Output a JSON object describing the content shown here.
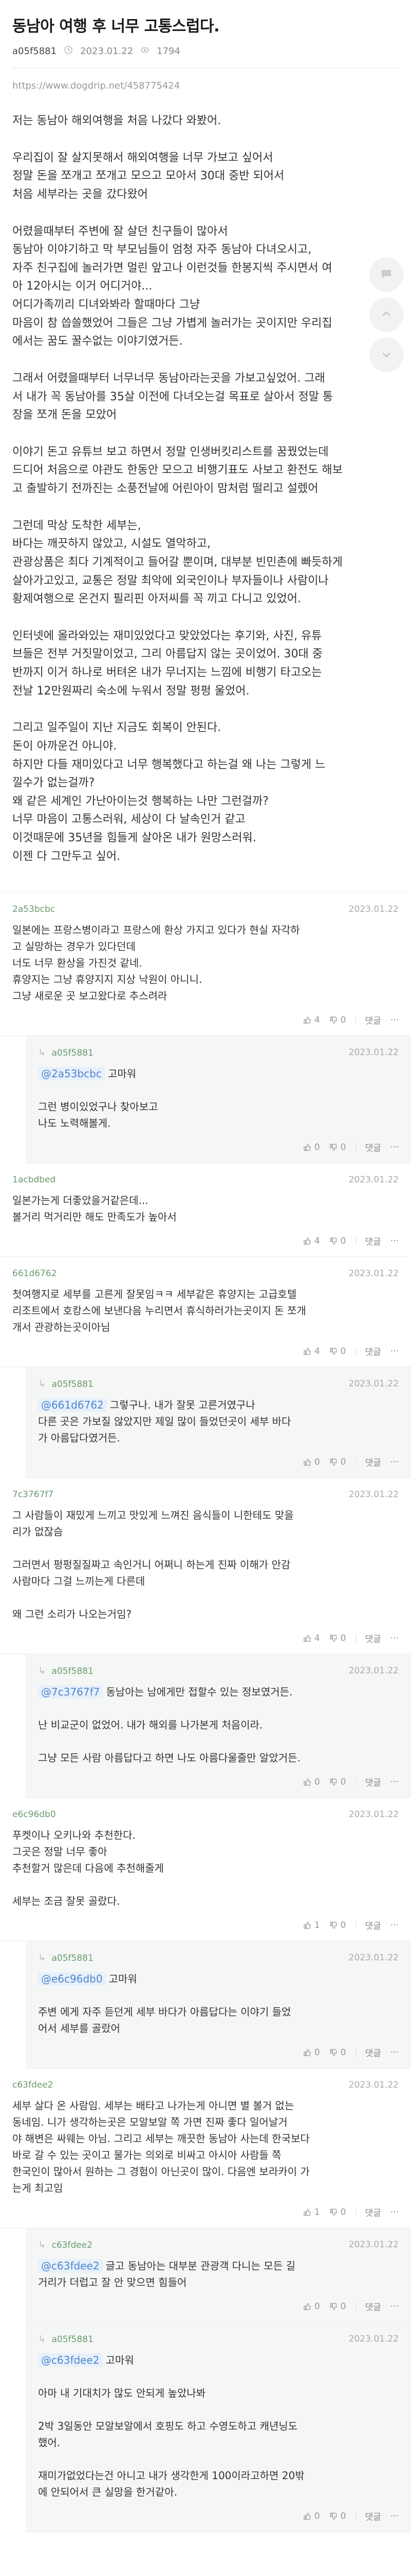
{
  "post": {
    "title": "동남아 여행 후 너무 고통스럽다.",
    "author": "a05f5881",
    "date": "2023.01.22",
    "views": "1794",
    "source": "https://www.dogdrip.net/458775424"
  },
  "body": [
    "저는 동남아 해외여행을 처음 나갔다 와봤어.",
    "우리집이 잘 살지못해서 해외여행을 너무 가보고 싶어서\n정말 돈을 쪼개고 쪼개고 모으고 모아서 30대 중반 되어서\n처음 세부라는 곳을 갔다왔어",
    "어렸을때부터 주변에 잘 살던 친구들이 많아서\n동남아 이야기하고 막 부모님들이 엄청 자주 동남아 다녀오시고,\n자주 친구집에 놀러가면 멀린 앞고나 이런것들 한봉지씩 주시면서 여\n아 12아시는 이거 어디거야...\n어디가족끼리 디녀와봐라 할때마다 그냥\n마음이 참 씁쓸했었어 그들은 그냥 가볍게 놀러가는 곳이지만 우리집\n에서는 꿈도 꿀수없는 이야기였거든.",
    "그래서 어렸을때부터 너무너무 동남아라는곳을 가보고싶었어. 그래\n서 내가 꼭 동남아를 35살 이전에 다녀오는걸 목표로 살아서 정말 통\n장을 쪼개 돈을 모았어",
    "이야기 돈고 유튜브 보고 하면서 정말 인생버킷리스트를 꿈꿨었는데\n드디어 처음으로 야관도 한동안 모으고 비행기표도 사보고 환전도 해보\n고 출발하기 전까진는 소풍전날에 어린아이 맘처럼 떨리고 설렜어",
    "그런데 막상 도착한 세부는,\n바다는 깨끗하지 않았고, 시설도 열악하고,\n관광상품은 최다 기계적이고 들어갈 뿐이며, 대부분 빈민촌에 빠듯하게\n살아가고있고, 교통은 정말 최악에 외국인이나 부자들이나 사람이나\n황제여행으로 온건지 필리핀 아저씨를 꼭 끼고 다니고 있었어.",
    "인터넷에 올라와있는 재미있었다고 맞았었다는 후기와, 사진, 유튜\n브들은 전부 거짓말이었고, 그리 아름답지 않는 곳이었어. 30대 중\n반까지 이거 하나로 버텨온 내가 무너지는 느낌에 비행기 타고오는\n전날 12만원짜리 숙소에 누워서 정말 펑펑 울었어.",
    "그리고 일주일이 지난 지금도 회복이 안된다.\n돈이 아까운건 아니야.\n하지만 다들 재미있다고 너무 행복했다고 하는걸 왜 나는 그렇게 느\n낄수가 없는걸까?\n왜 같은 세계인 가난아이는것 행복하는 나만 그런걸까?\n너무 마음이 고통스러워, 세상이 다 날속인거 같고\n이것때문에  35년을 힘들게 살아온 내가 원망스러워.\n이젠 다 그만두고 싶어."
  ],
  "comments": [
    {
      "nick": "2a53bcbc",
      "date": "2023.01.22",
      "mention": "",
      "text": "일본에는 프랑스병이라고 프랑스에 환상 가지고 있다가 현실 자각하\n고 실망하는 경우가 있다던데\n너도 너무 환상을 가진것 같네.\n휴양지는 그냥 휴양지지 지상 낙원이 아니니.\n그냥 새로운 곳 보고왔다로 추스려라",
      "likes": "4",
      "dislikes": "0",
      "reply": false
    },
    {
      "nick": "a05f5881",
      "date": "2023.01.22",
      "mention": "@2a53bcbc",
      "text": "고마워\n\n그런 병이있었구나 찾아보고\n나도 노력해볼게.",
      "likes": "0",
      "dislikes": "0",
      "reply": true
    },
    {
      "nick": "1acbdbed",
      "date": "2023.01.22",
      "mention": "",
      "text": "일본가는게 더좋았을거같은데...\n볼거리 먹거리만 해도 만족도가 높아서",
      "likes": "4",
      "dislikes": "0",
      "reply": false
    },
    {
      "nick": "661d6762",
      "date": "2023.01.22",
      "mention": "",
      "text": "첫여행지로 세부를 고른게 잘못임ㅋㅋ 세부같은 휴양지는 고급호텔\n리조트에서 호캉스에 보낸다음 누리면서 휴식하러가는곳이지 돈 쪼개\n개서 관광하는곳이아님",
      "likes": "4",
      "dislikes": "0",
      "reply": false
    },
    {
      "nick": "a05f5881",
      "date": "2023.01.22",
      "mention": "@661d6762",
      "text": "그렇구나. 내가 잘못 고른거였구나\n다른 곳은 가보질 않았지만 제일 많이 들었던곳이 세부 바다\n가 아름답다였거든.",
      "likes": "0",
      "dislikes": "0",
      "reply": true
    },
    {
      "nick": "7c3767f7",
      "date": "2023.01.22",
      "mention": "",
      "text": "그 사람들이 재밌게 느끼고 맛있게 느껴진 음식들이 니한테도 맞을\n리가 없잖슴\n\n그러면서 펑펑질질짜고 속인거니 어쩌니 하는게 진짜 이해가 안감\n사람마다 그걸 느끼는게 다른데\n\n왜 그런 소리가 나오는거임?",
      "likes": "4",
      "dislikes": "0",
      "reply": false
    },
    {
      "nick": "a05f5881",
      "date": "2023.01.22",
      "mention": "@7c3767f7",
      "text": "동남아는 남에게만 접할수 있는 정보였거든.\n\n난 비교군이 없었어. 내가 해외를 나가본게 처음이라.\n\n그냥 모든 사람 아름답다고 하면 나도 아름다울줄만 알았거든.",
      "likes": "0",
      "dislikes": "0",
      "reply": true
    },
    {
      "nick": "e6c96db0",
      "date": "2023.01.22",
      "mention": "",
      "text": "푸켓이나 오키나와 추천한다.\n그곳은 정말 너무 좋아\n추천할거 많은데 다음에 추천해줄게\n\n세부는 조금 잘못 골랐다.",
      "likes": "1",
      "dislikes": "0",
      "reply": false
    },
    {
      "nick": "a05f5881",
      "date": "2023.01.22",
      "mention": "@e6c96db0",
      "text": "고마워\n\n주변 에게 자주 듣던게 세부 바다가 아름답다는 이야기 들었\n어서 세부를 골랐어",
      "likes": "0",
      "dislikes": "0",
      "reply": true
    },
    {
      "nick": "c63fdee2",
      "date": "2023.01.22",
      "mention": "",
      "text": "세부 살다 온 사람임. 세부는 배타고 나가는게 아니면 별 볼거 없는\n동네임. 니가 생각하는곳은 모알보알 쪽 가면 진짜 좋다 일어날거\n야 해변은 싸웨는 아님. 그리고 세부는 깨끗한 동남아 사는데 한국보다\n바로 갈 수 있는 곳이고 물가는 의외로 비싸고 아시아 사람들 쪽\n한국인이 많아서 원하는 그 경험이 아닌곳이 많이. 다음엔 보라카이 가\n는게 최고임",
      "likes": "1",
      "dislikes": "0",
      "reply": false
    },
    {
      "nick": "c63fdee2",
      "date": "2023.01.22",
      "mention": "@c63fdee2",
      "text": "글고 동남아는 대부분 관광객 다니는 모든 길\n거리가 더럽고 잘 안 맞으면 힘들어",
      "likes": "0",
      "dislikes": "0",
      "reply": true
    },
    {
      "nick": "a05f5881",
      "date": "2023.01.22",
      "mention": "@c63fdee2",
      "text": "고마워\n\n아마 내 기대치가 많도 안되게 높았나봐\n\n2박 3일동안 모알보알에서 호핑도 하고 수영도하고 캐년닝도\n했어.\n\n재미가없었다는건 아니고 내가 생각한게 100이라고하면 20밖\n에 안되어서 큰 실망을 한거같아.",
      "likes": "0",
      "dislikes": "0",
      "reply": true
    }
  ],
  "labels": {
    "reply_button": "댓글",
    "more_button": "···"
  },
  "colors": {
    "nick": "#6c9b70",
    "mention": "#4d87cf",
    "reply_bg": "#f4f7f5"
  }
}
